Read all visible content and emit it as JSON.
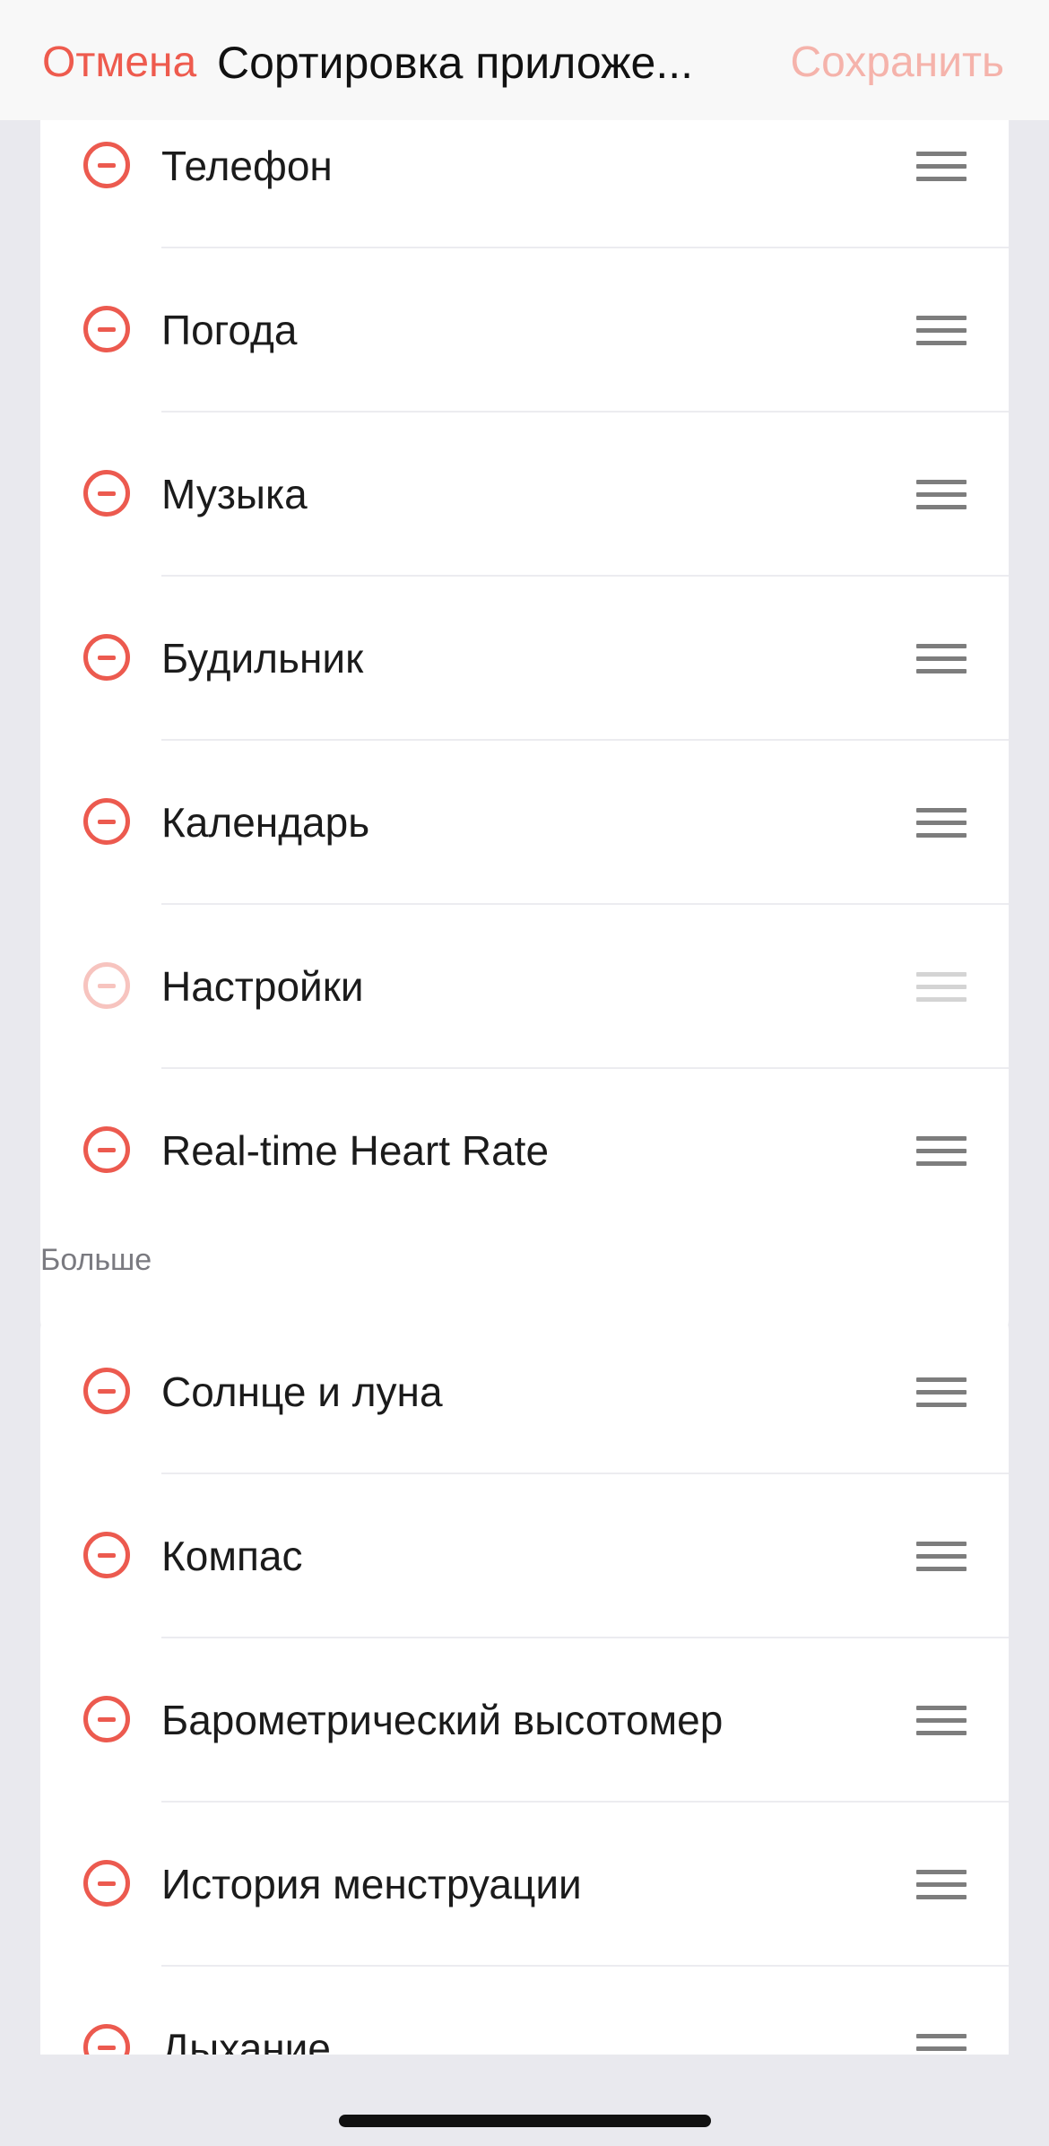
{
  "header": {
    "cancel_label": "Отмена",
    "title": "Сортировка приложе...",
    "save_label": "Сохранить"
  },
  "main_list": {
    "items": [
      {
        "label": "Телефон"
      },
      {
        "label": "Погода"
      },
      {
        "label": "Музыка"
      },
      {
        "label": "Будильник"
      },
      {
        "label": "Календарь"
      },
      {
        "label": "Настройки",
        "state": "disabled"
      },
      {
        "label": "Real-time Heart Rate"
      }
    ]
  },
  "more_section": {
    "title": "Больше",
    "items": [
      {
        "label": "Солнце и луна"
      },
      {
        "label": "Компас"
      },
      {
        "label": "Барометрический высотомер"
      },
      {
        "label": "История менструации"
      },
      {
        "label": "Дыхание"
      }
    ]
  },
  "colors": {
    "accent": "#ec5a4f",
    "accent_disabled": "#f7c4bf",
    "background": "#e9e9ee",
    "card": "#ffffff"
  },
  "icons": {
    "remove": "minus-circle-icon",
    "reorder": "drag-handle-icon"
  }
}
